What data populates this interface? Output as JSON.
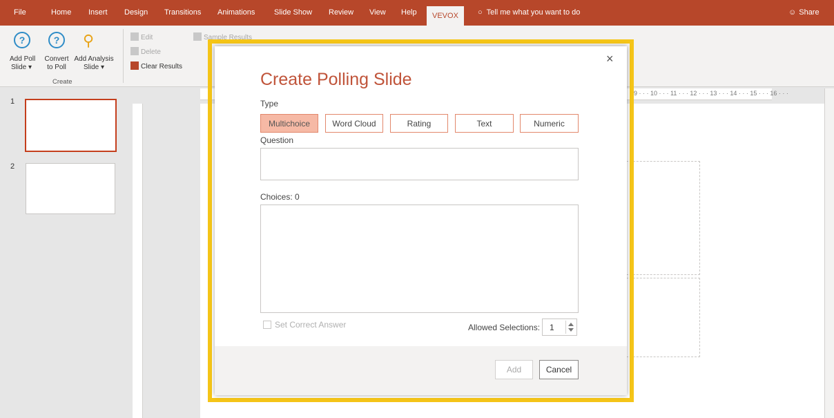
{
  "menubar": {
    "tabs": [
      "File",
      "Home",
      "Insert",
      "Design",
      "Transitions",
      "Animations",
      "Slide Show",
      "Review",
      "View",
      "Help",
      "VEVOX"
    ],
    "active_tab": "VEVOX",
    "tell_me": "Tell me what you want to do",
    "share": "Share",
    "accent_color": "#b7472a"
  },
  "ribbon": {
    "add_poll": "Add Poll\nSlide ▾",
    "convert_poll": "Convert\nto Poll",
    "add_analysis": "Add Analysis\nSlide ▾",
    "create_group": "Create",
    "edit": "Edit",
    "delete": "Delete",
    "clear_results": "Clear Results",
    "sample_results": "Sample Results"
  },
  "slides": [
    {
      "number": "1",
      "selected": true
    },
    {
      "number": "2",
      "selected": false
    }
  ],
  "hruler": "9 · · · 10 · · · 11 · · · 12 · · · 13 · · · 14 · · · 15 · · · 16 · · ·",
  "dialog": {
    "title": "Create Polling Slide",
    "close": "×",
    "type_label": "Type",
    "types": [
      "Multichoice",
      "Word Cloud",
      "Rating",
      "Text",
      "Numeric"
    ],
    "selected_type": "Multichoice",
    "question_label": "Question",
    "question_value": "",
    "choices_label": "Choices: 0",
    "set_correct_answer": "Set Correct Answer",
    "allowed_selections_label": "Allowed Selections:",
    "allowed_selections_value": "1",
    "add_button": "Add",
    "cancel_button": "Cancel",
    "highlight_color": "#f5c518"
  }
}
